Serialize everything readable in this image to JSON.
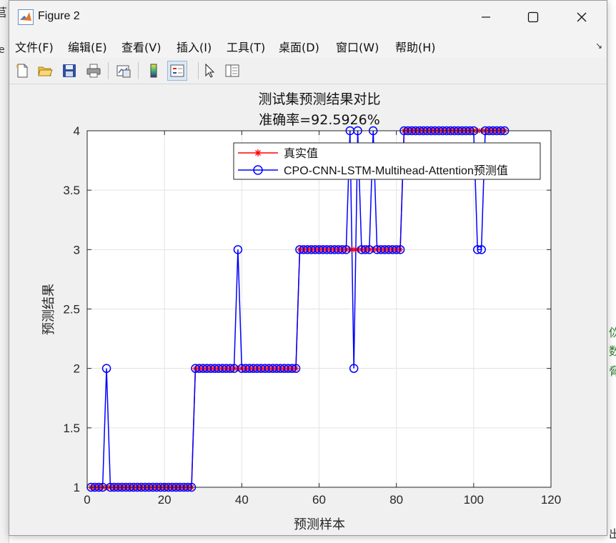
{
  "window": {
    "title": "Figure 2",
    "icon": "matlab-logo-icon",
    "controls": [
      "minimize-icon",
      "maximize-icon",
      "close-icon"
    ]
  },
  "menubar": {
    "items": [
      "文件(F)",
      "编辑(E)",
      "查看(V)",
      "插入(I)",
      "工具(T)",
      "桌面(D)",
      "窗口(W)",
      "帮助(H)"
    ],
    "dock_icon": "↘"
  },
  "toolbar": {
    "buttons": [
      {
        "icon": "new-figure-icon"
      },
      {
        "icon": "open-file-icon"
      },
      {
        "icon": "save-icon"
      },
      {
        "icon": "print-icon"
      },
      {
        "icon": "link-plot-icon"
      },
      {
        "icon": "colorbar-icon"
      },
      {
        "icon": "legend-icon",
        "active": true
      },
      {
        "icon": "pointer-icon"
      },
      {
        "icon": "property-inspector-icon"
      }
    ]
  },
  "background": {
    "left_glyphs": [
      "苢",
      "e"
    ],
    "right_glyphs": [
      "佽",
      "数",
      "脅",
      "出"
    ]
  },
  "chart_data": {
    "type": "line",
    "title": "测试集预测结果对比",
    "subtitle": "准确率=92.5926%",
    "xlabel": "预测样本",
    "ylabel": "预测结果",
    "xlim": [
      0,
      120
    ],
    "ylim": [
      1,
      4
    ],
    "xticks": [
      "0",
      "20",
      "40",
      "60",
      "80",
      "100",
      "120"
    ],
    "yticks": [
      "1",
      "1.5",
      "2",
      "2.5",
      "3",
      "3.5",
      "4"
    ],
    "grid": true,
    "legend_position": "top-right",
    "series": [
      {
        "name": "真实值",
        "color": "#ff0000",
        "marker": "*",
        "values": [
          1,
          1,
          1,
          1,
          1,
          1,
          1,
          1,
          1,
          1,
          1,
          1,
          1,
          1,
          1,
          1,
          1,
          1,
          1,
          1,
          1,
          1,
          1,
          1,
          1,
          1,
          1,
          2,
          2,
          2,
          2,
          2,
          2,
          2,
          2,
          2,
          2,
          2,
          2,
          2,
          2,
          2,
          2,
          2,
          2,
          2,
          2,
          2,
          2,
          2,
          2,
          2,
          2,
          2,
          3,
          3,
          3,
          3,
          3,
          3,
          3,
          3,
          3,
          3,
          3,
          3,
          3,
          3,
          3,
          3,
          3,
          3,
          3,
          3,
          3,
          3,
          3,
          3,
          3,
          3,
          3,
          4,
          4,
          4,
          4,
          4,
          4,
          4,
          4,
          4,
          4,
          4,
          4,
          4,
          4,
          4,
          4,
          4,
          4,
          4,
          4,
          4,
          4,
          4,
          4,
          4,
          4,
          4
        ]
      },
      {
        "name": "CPO-CNN-LSTM-Multihead-Attention预测值",
        "color": "#0000ff",
        "marker": "o",
        "values": [
          1,
          1,
          1,
          1,
          2,
          1,
          1,
          1,
          1,
          1,
          1,
          1,
          1,
          1,
          1,
          1,
          1,
          1,
          1,
          1,
          1,
          1,
          1,
          1,
          1,
          1,
          1,
          2,
          2,
          2,
          2,
          2,
          2,
          2,
          2,
          2,
          2,
          2,
          3,
          2,
          2,
          2,
          2,
          2,
          2,
          2,
          2,
          2,
          2,
          2,
          2,
          2,
          2,
          2,
          3,
          3,
          3,
          3,
          3,
          3,
          3,
          3,
          3,
          3,
          3,
          3,
          3,
          4,
          2,
          4,
          3,
          3,
          3,
          4,
          3,
          3,
          3,
          3,
          3,
          3,
          3,
          4,
          4,
          4,
          4,
          4,
          4,
          4,
          4,
          4,
          4,
          4,
          4,
          4,
          4,
          4,
          4,
          4,
          4,
          4,
          3,
          3,
          4,
          4,
          4,
          4,
          4,
          4
        ]
      }
    ]
  }
}
